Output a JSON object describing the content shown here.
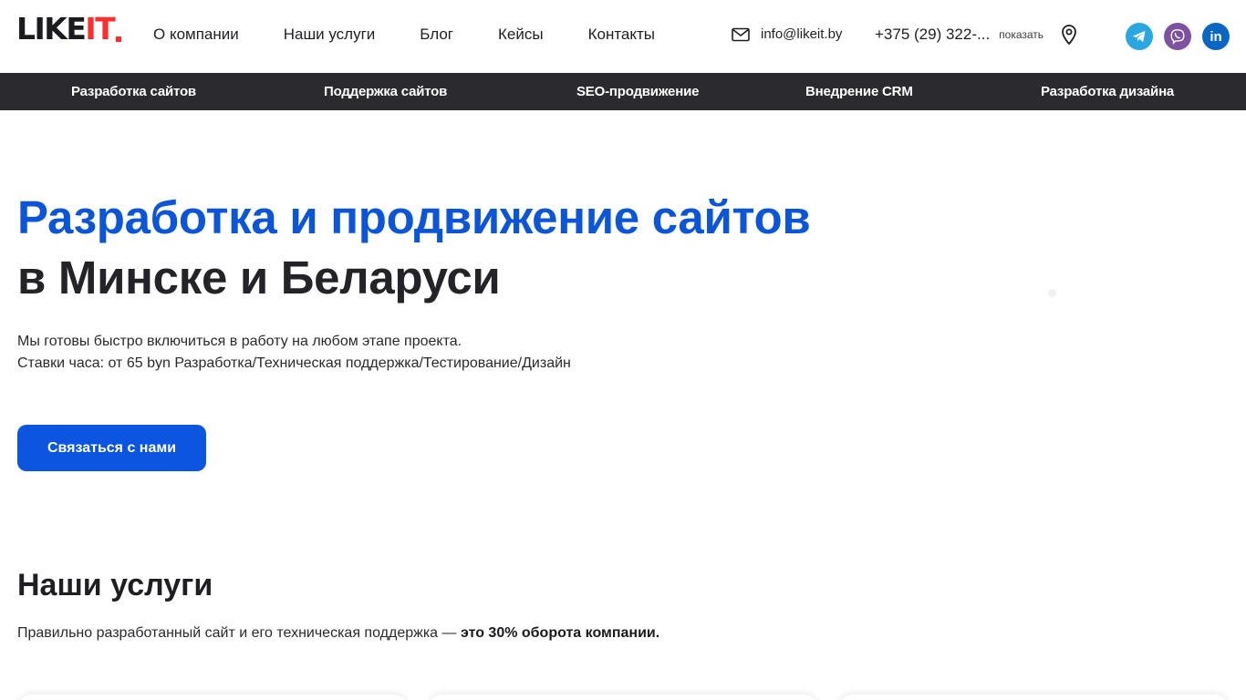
{
  "header": {
    "logo": {
      "like": "LIKE",
      "it": "IT"
    },
    "nav": [
      {
        "label": "О компании"
      },
      {
        "label": "Наши услуги"
      },
      {
        "label": "Блог"
      },
      {
        "label": "Кейсы"
      },
      {
        "label": "Контакты"
      }
    ],
    "email": "info@likeit.by",
    "phone": "+375 (29) 322-...",
    "phone_show": "показать",
    "icons": {
      "mail": "mail-icon",
      "location": "map-pin-icon",
      "telegram": "telegram-icon",
      "viber": "viber-icon",
      "linkedin": "linkedin-icon"
    },
    "linkedin_glyph": "in"
  },
  "subnav": [
    {
      "label": "Разработка сайтов"
    },
    {
      "label": "Поддержка сайтов"
    },
    {
      "label": "SEO-продвижение"
    },
    {
      "label": "Внедрение CRM"
    },
    {
      "label": "Разработка дизайна"
    }
  ],
  "hero": {
    "title_line1": "Разработка и продвижение сайтов",
    "title_line2": "в Минске и Беларуси",
    "description_line1": "Мы готовы быстро включиться в работу на любом этапе проекта.",
    "description_line2": "Ставки часа: от 65 byn Разработка/Техническая поддержка/Тестирование/Дизайн",
    "cta_label": "Связаться с нами"
  },
  "services": {
    "title": "Наши услуги",
    "subtitle_regular": "Правильно разработанный сайт и его техническая поддержка — ",
    "subtitle_bold": "это 30% оборота компании."
  },
  "colors": {
    "accent_blue": "#0c55d6",
    "logo_red": "#ff2d2d",
    "subnav_bg": "#2a2a2f",
    "telegram": "#2aa6e0",
    "viber": "#7d51a0",
    "linkedin": "#0a66c2"
  }
}
